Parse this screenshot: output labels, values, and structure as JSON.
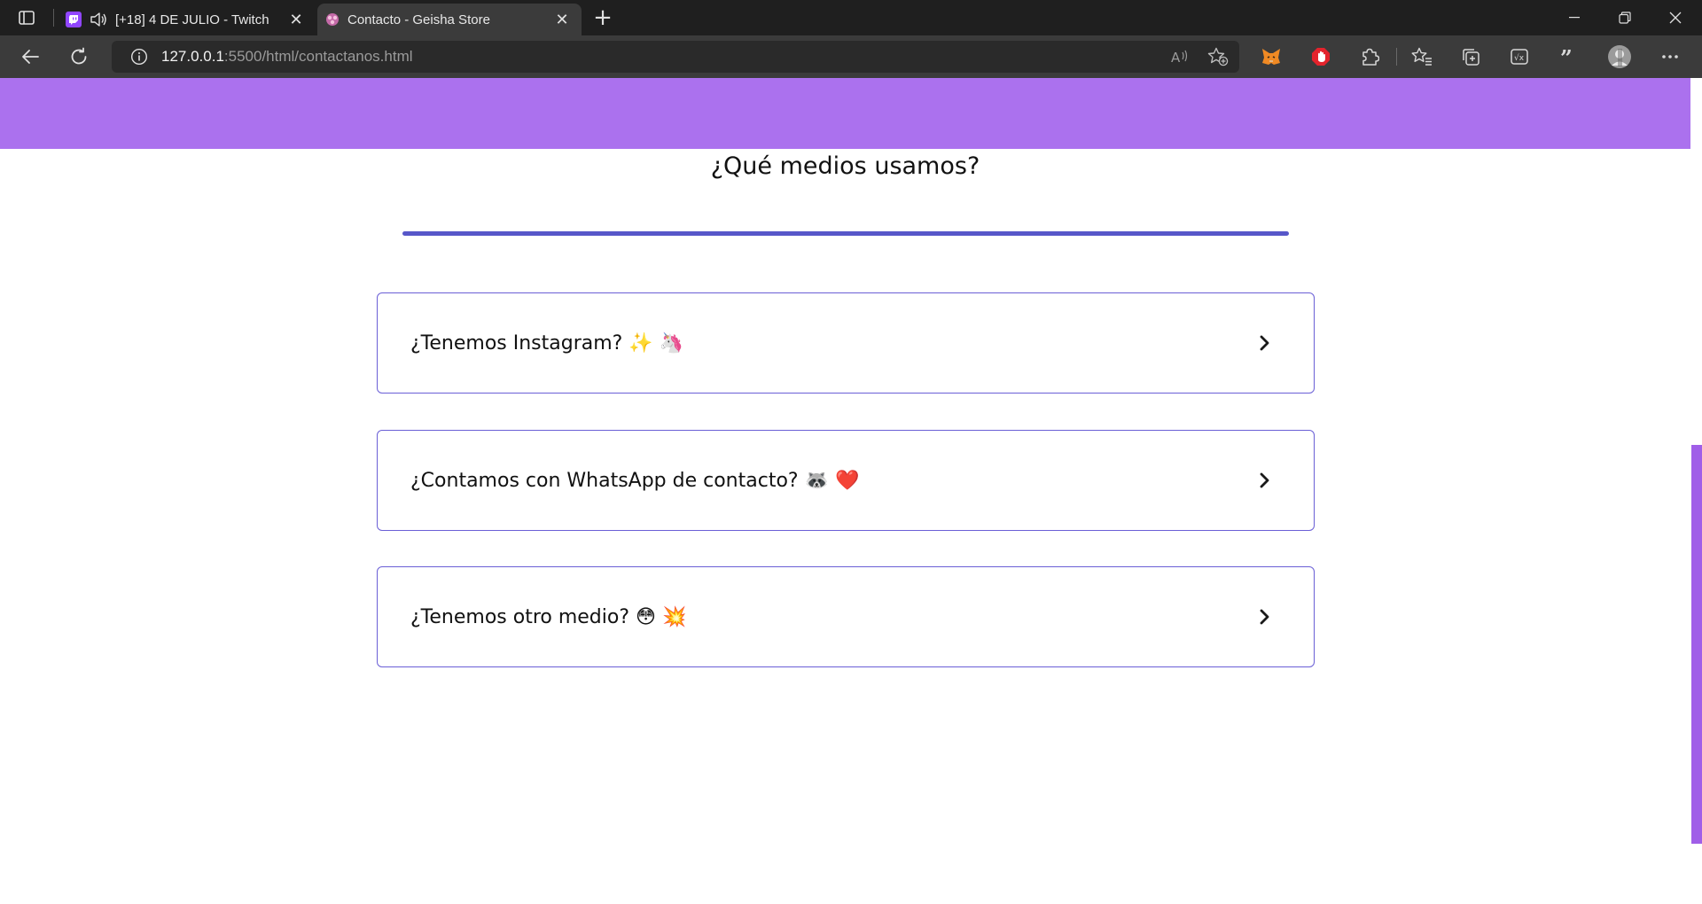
{
  "browser": {
    "tabs": [
      {
        "title": "[+18] 4 DE JULIO - Twitch",
        "favicon": "twitch-icon",
        "audio": true,
        "active": false
      },
      {
        "title": "Contacto - Geisha Store",
        "favicon": "geisha-store-icon",
        "active": true
      }
    ],
    "address": {
      "host": "127.0.0.1",
      "path": ":5500/html/contactanos.html"
    }
  },
  "page": {
    "section_title": "¿Qué medios usamos?",
    "faq": [
      {
        "question": "¿Tenemos Instagram? ✨ 🦄"
      },
      {
        "question": "¿Contamos con WhatsApp de contacto? 🦝 ❤️"
      },
      {
        "question": "¿Tenemos otro medio? 😳 💥"
      }
    ]
  },
  "colors": {
    "hero_band": "#ab71ee",
    "divider": "#5757c9",
    "card_border": "#6a5fd6",
    "scrollbar": "#a05ee8"
  }
}
